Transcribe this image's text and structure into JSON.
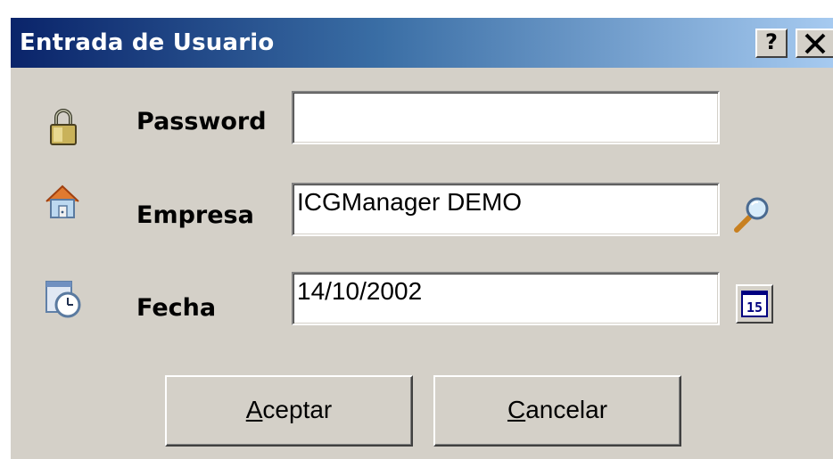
{
  "window": {
    "title": "Entrada de Usuario",
    "help_label": "?",
    "close_label": "✕"
  },
  "form": {
    "password": {
      "label": "Password",
      "value": ""
    },
    "empresa": {
      "label": "Empresa",
      "value": "ICGManager DEMO"
    },
    "fecha": {
      "label": "Fecha",
      "value": "14/10/2002",
      "calendar_day": "15"
    }
  },
  "buttons": {
    "accept": {
      "accel": "A",
      "rest": "ceptar"
    },
    "cancel": {
      "accel": "C",
      "rest": "ancelar"
    }
  },
  "icons": {
    "password": "padlock-icon",
    "empresa": "house-icon",
    "fecha": "clock-calendar-icon",
    "search": "magnifier-icon",
    "calendar": "calendar-icon"
  },
  "colors": {
    "titlebar_start": "#0a246a",
    "titlebar_end": "#a6caf0",
    "dialog_face": "#d4d0c8"
  }
}
